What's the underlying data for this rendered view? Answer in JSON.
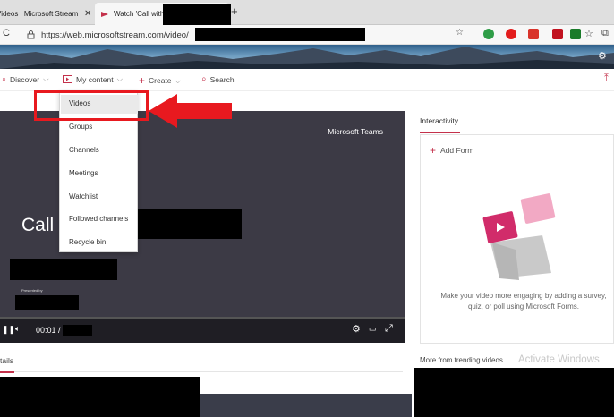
{
  "browser": {
    "tabs": [
      {
        "title": "Videos | Microsoft Stream",
        "close": "✕"
      },
      {
        "title": "Watch 'Call with",
        "close": "✕"
      }
    ],
    "new_tab": "+",
    "url": "https://web.microsoftstream.com/video/"
  },
  "nav": {
    "discover": "Discover",
    "my_content": "My content",
    "create": "Create",
    "search": "Search"
  },
  "dropdown": {
    "items": [
      "Videos",
      "Groups",
      "Channels",
      "Meetings",
      "Watchlist",
      "Followed channels",
      "Recycle bin"
    ]
  },
  "video": {
    "title": "Call",
    "brand": "Microsoft Teams",
    "presented_by": "Presented by",
    "time": "00:01 /"
  },
  "interactivity": {
    "tab_label": "Interactivity",
    "add_form": "Add Form",
    "message": "Make your video more engaging by adding a survey, quiz, or poll using Microsoft Forms."
  },
  "bottom": {
    "details": "tails",
    "trending": "More from trending videos",
    "watermark": "Activate Windows"
  },
  "colors": {
    "accent": "#c4314b",
    "callout": "#e8191f"
  }
}
